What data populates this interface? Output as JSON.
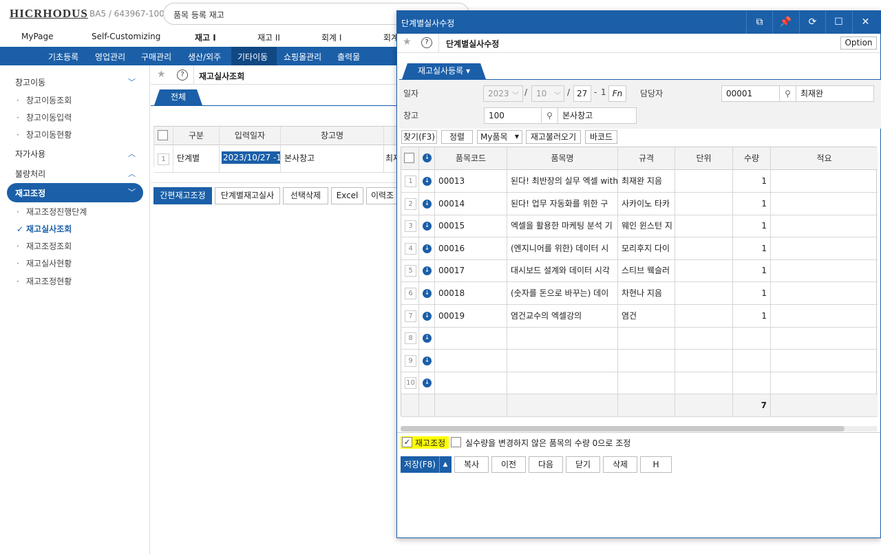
{
  "header": {
    "logo": "HICRHODUS",
    "company": "BA5 / 643967-100",
    "search_value": "품목 등록 재고",
    "main_nav": [
      "MyPage",
      "Self-Customizing",
      "재고 I",
      "재고 II",
      "회계 I",
      "회계"
    ],
    "sub_nav": [
      "기초등록",
      "영업관리",
      "구매관리",
      "생산/외주",
      "기타이동",
      "쇼핑몰관리",
      "출력물"
    ],
    "sub_nav_active": "기타이동"
  },
  "sidebar": {
    "groups": [
      {
        "label": "창고이동",
        "items": [
          "창고이동조회",
          "창고이동입력",
          "창고이동현황"
        ]
      },
      {
        "label": "자가사용"
      },
      {
        "label": "불량처리"
      },
      {
        "label": "재고조정",
        "items": [
          "재고조정진행단계",
          "재고실사조회",
          "재고조정조회",
          "재고실사현황",
          "재고조정현황"
        ]
      }
    ],
    "active_item": "재고실사조회"
  },
  "main": {
    "title": "재고실사조회",
    "tab": "전체",
    "table": {
      "headers": [
        "구분",
        "입력일자",
        "창고명"
      ],
      "row": {
        "num": "1",
        "type": "단계별",
        "date": "2023/10/27 -1",
        "warehouse": "본사창고",
        "extra": "최재"
      }
    },
    "buttons": [
      "간편재고조정",
      "단계별재고실사",
      "선택삭제",
      "Excel",
      "이력조"
    ]
  },
  "modal": {
    "window_title": "단계별실사수정",
    "page_title": "단계별실사수정",
    "option_label": "Option",
    "tab": "재고실사등록 ▾",
    "form": {
      "date_label": "일자",
      "year": "2023",
      "month": "10",
      "day": "27",
      "seq": "1",
      "fn_label": "Fn",
      "manager_label": "담당자",
      "manager_code": "00001",
      "manager_name": "최재완",
      "warehouse_label": "창고",
      "warehouse_code": "100",
      "warehouse_name": "본사창고"
    },
    "toolbar": [
      "찾기(F3)",
      "정렬",
      "My품목",
      "재고불러오기",
      "바코드"
    ],
    "grid": {
      "headers": [
        "품목코드",
        "품목명",
        "규격",
        "단위",
        "수량",
        "적요"
      ],
      "rows": [
        {
          "num": "1",
          "code": "00013",
          "name": "된다! 최반장의 실무 엑셀 with",
          "spec": "최재완 지음",
          "qty": "1"
        },
        {
          "num": "2",
          "code": "00014",
          "name": "된다! 업무 자동화를 위한 구",
          "spec": "사카이노 타카",
          "qty": "1"
        },
        {
          "num": "3",
          "code": "00015",
          "name": "엑셀을 활용한 마케팅 분석 기",
          "spec": "웨인 윈스턴 지",
          "qty": "1"
        },
        {
          "num": "4",
          "code": "00016",
          "name": "(엔지니어를 위한) 데이터 시",
          "spec": "모리후지 다이",
          "qty": "1"
        },
        {
          "num": "5",
          "code": "00017",
          "name": "대시보드 설계와 데이터 시각",
          "spec": "스티브 웩슬러",
          "qty": "1"
        },
        {
          "num": "6",
          "code": "00018",
          "name": "(숫자를 돈으로 바꾸는) 데이",
          "spec": "차현나 지음",
          "qty": "1"
        },
        {
          "num": "7",
          "code": "00019",
          "name": "염건교수의 엑셀강의",
          "spec": "염건",
          "qty": "1"
        },
        {
          "num": "8",
          "code": "",
          "name": "",
          "spec": "",
          "qty": ""
        },
        {
          "num": "9",
          "code": "",
          "name": "",
          "spec": "",
          "qty": ""
        },
        {
          "num": "10",
          "code": "",
          "name": "",
          "spec": "",
          "qty": ""
        }
      ],
      "total_qty": "7"
    },
    "checkbox1_label": "재고조정",
    "checkbox2_label": "실수량을 변경하지 않은 품목의 수량 0으로 조정",
    "buttons": {
      "save": "저장(F8)",
      "copy": "복사",
      "prev": "이전",
      "next": "다음",
      "close": "닫기",
      "delete": "삭제",
      "h": "H"
    }
  },
  "colors": {
    "primary": "#1b5fa8",
    "highlight": "#ffff00"
  }
}
